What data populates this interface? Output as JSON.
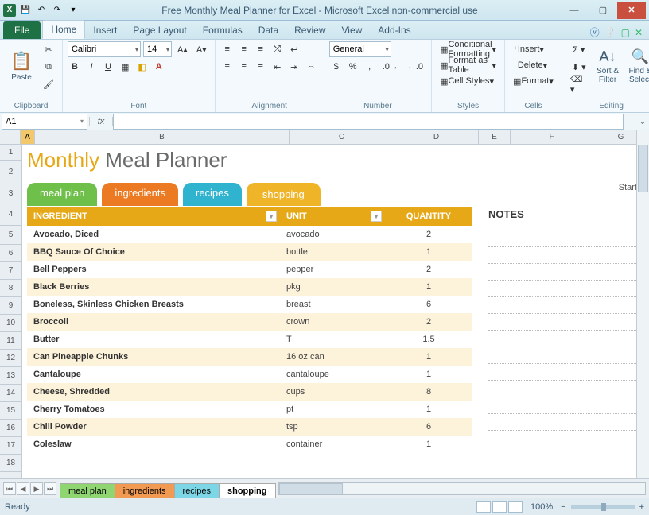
{
  "window": {
    "title": "Free Monthly Meal Planner for Excel  -  Microsoft Excel non-commercial use"
  },
  "ribbon_tabs": [
    "File",
    "Home",
    "Insert",
    "Page Layout",
    "Formulas",
    "Data",
    "Review",
    "View",
    "Add-Ins"
  ],
  "active_ribbon_tab": "Home",
  "ribbon": {
    "clipboard": {
      "label": "Clipboard",
      "paste": "Paste"
    },
    "font": {
      "label": "Font",
      "name": "Calibri",
      "size": "14"
    },
    "alignment": {
      "label": "Alignment"
    },
    "number": {
      "label": "Number",
      "format": "General"
    },
    "styles": {
      "label": "Styles",
      "cf": "Conditional Formatting",
      "fat": "Format as Table",
      "cs": "Cell Styles"
    },
    "cells": {
      "label": "Cells",
      "insert": "Insert",
      "delete": "Delete",
      "format": "Format"
    },
    "editing": {
      "label": "Editing",
      "sort": "Sort &\nFilter",
      "find": "Find &\nSelect"
    }
  },
  "namebox": "A1",
  "fx": "fx",
  "columns": [
    "A",
    "B",
    "C",
    "D",
    "E",
    "F",
    "G"
  ],
  "row_numbers": [
    1,
    2,
    3,
    4,
    5,
    6,
    7,
    8,
    9,
    10,
    11,
    12,
    13,
    14,
    15,
    16,
    17,
    18
  ],
  "doc": {
    "title_monthly": "Monthly",
    "title_mealplanner": " Meal Planner",
    "startd": "Start D",
    "tabs": {
      "meal": "meal plan",
      "ingredients": "ingredients",
      "recipes": "recipes",
      "shopping": "shopping"
    },
    "headers": {
      "ingredient": "INGREDIENT",
      "unit": "UNIT",
      "quantity": "QUANTITY",
      "notes": "NOTES"
    },
    "rows": [
      {
        "i": "Avocado, Diced",
        "u": "avocado",
        "q": "2"
      },
      {
        "i": "BBQ Sauce Of Choice",
        "u": "bottle",
        "q": "1"
      },
      {
        "i": "Bell Peppers",
        "u": "pepper",
        "q": "2"
      },
      {
        "i": "Black Berries",
        "u": "pkg",
        "q": "1"
      },
      {
        "i": "Boneless, Skinless Chicken Breasts",
        "u": "breast",
        "q": "6"
      },
      {
        "i": "Broccoli",
        "u": "crown",
        "q": "2"
      },
      {
        "i": "Butter",
        "u": "T",
        "q": "1.5"
      },
      {
        "i": "Can Pineapple Chunks",
        "u": "16 oz can",
        "q": "1"
      },
      {
        "i": "Cantaloupe",
        "u": "cantaloupe",
        "q": "1"
      },
      {
        "i": "Cheese, Shredded",
        "u": "cups",
        "q": "8"
      },
      {
        "i": "Cherry Tomatoes",
        "u": "pt",
        "q": "1"
      },
      {
        "i": "Chili Powder",
        "u": "tsp",
        "q": "6"
      },
      {
        "i": "Coleslaw",
        "u": "container",
        "q": "1"
      }
    ]
  },
  "sheet_tabs": [
    "meal plan",
    "ingredients",
    "recipes",
    "shopping"
  ],
  "status": {
    "ready": "Ready",
    "zoom": "100%"
  }
}
